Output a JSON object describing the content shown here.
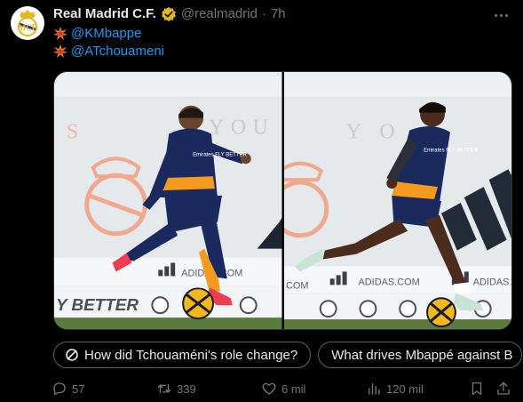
{
  "tweet": {
    "display_name": "Real Madrid C.F.",
    "handle": "@realmadrid",
    "separator": "·",
    "time": "7h",
    "lines": [
      {
        "emoji": "collision-emoji",
        "mention": "@KMbappe"
      },
      {
        "emoji": "collision-emoji",
        "mention": "@ATchouameni"
      }
    ]
  },
  "media": {
    "left_photo": {
      "wall_letters": [
        "S",
        "Y",
        "O",
        "U"
      ],
      "ad_text": "ADIDAS.COM",
      "banner_text": "Y BETTER",
      "shirt_text": "Emirates FLY BETTER"
    },
    "right_photo": {
      "wall_letters": [
        "Y",
        "O"
      ],
      "ad_text": "ADIDAS.COM",
      "ad_text_2": "ADIDAS.",
      "shirt_text": "Emirates FLY BETTER",
      "left_edge_text": "COM"
    }
  },
  "grok_chips": [
    {
      "label": "How did Tchouaméni's role change?"
    },
    {
      "label": "What drives Mbappé against B"
    }
  ],
  "actions": {
    "replies": "57",
    "reposts": "339",
    "likes": "6 mil",
    "views": "120 mil"
  },
  "colors": {
    "background": "#000000",
    "text": "#e7e9ea",
    "muted": "#71767b",
    "link": "#1d9bf0",
    "verified": "#e2b719",
    "kit_navy": "#1a2a5e",
    "kit_orange": "#f39a1f"
  }
}
